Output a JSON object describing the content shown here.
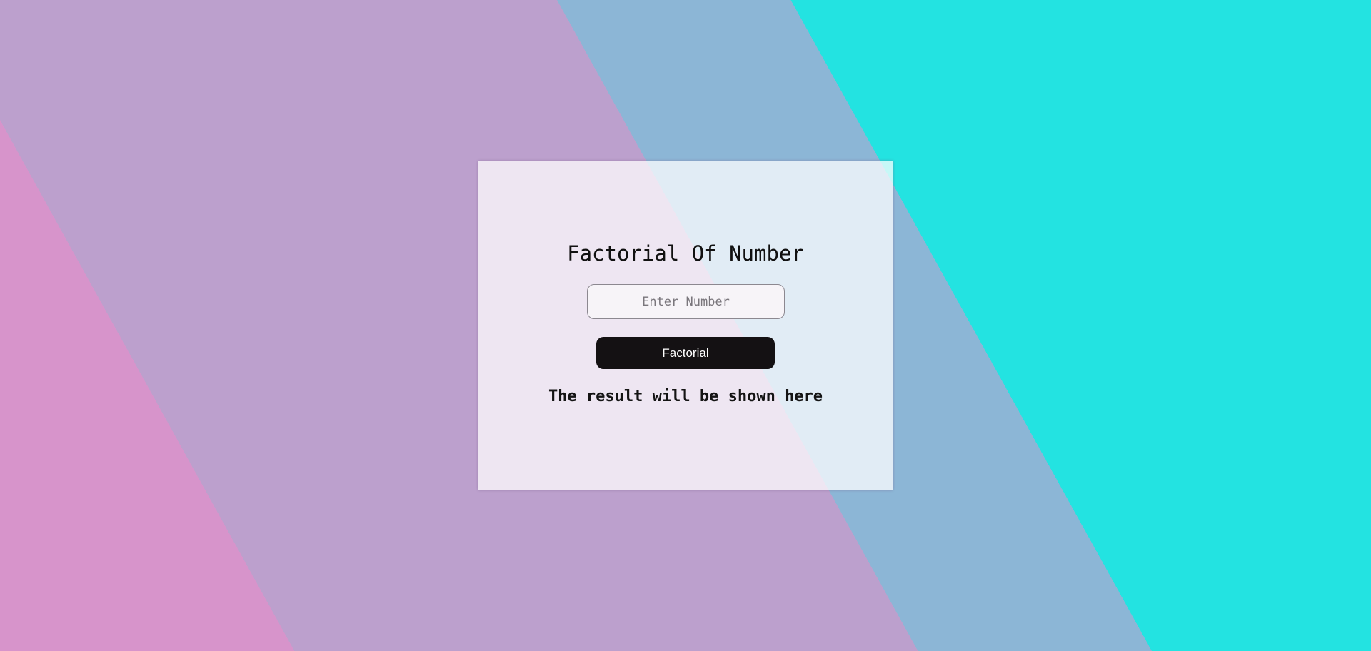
{
  "card": {
    "title": "Factorial Of Number",
    "input": {
      "value": "",
      "placeholder": "Enter Number"
    },
    "button_label": "Factorial",
    "result_text": "The result will be shown here"
  },
  "colors": {
    "background_pink": "#d794cb",
    "background_lavender": "#bca0cd",
    "background_blue": "#8cb6d6",
    "background_cyan": "#23e3e1",
    "button_background": "#141113",
    "button_text": "#ffffff"
  }
}
